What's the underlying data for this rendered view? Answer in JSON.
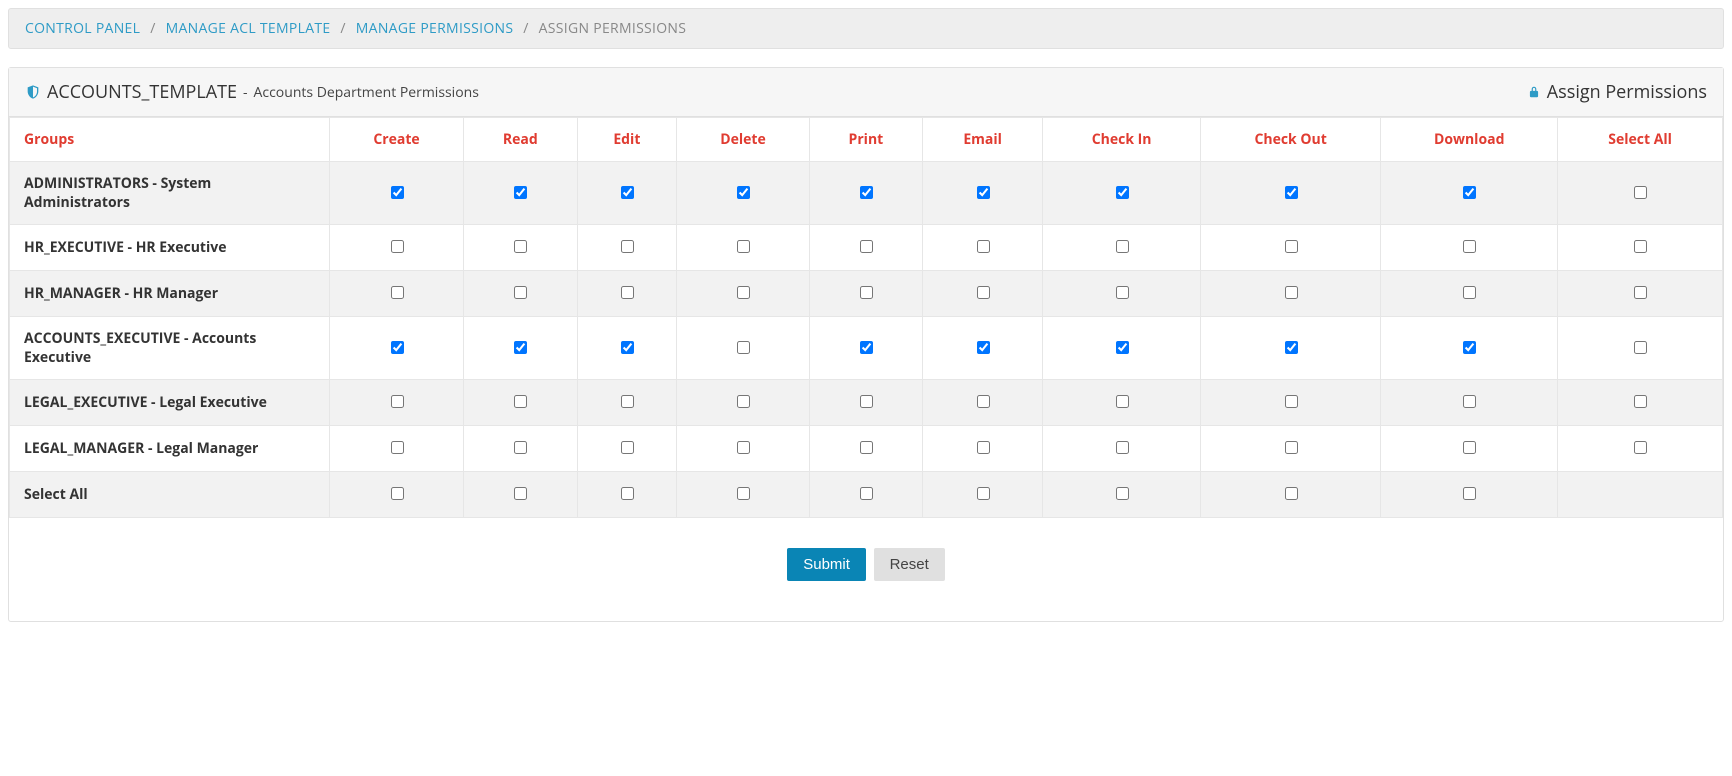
{
  "breadcrumb": {
    "items": [
      {
        "label": "CONTROL PANEL",
        "link": true
      },
      {
        "label": "MANAGE ACL TEMPLATE",
        "link": true
      },
      {
        "label": "MANAGE PERMISSIONS",
        "link": true
      },
      {
        "label": "ASSIGN PERMISSIONS",
        "link": false
      }
    ]
  },
  "panel": {
    "title_main": "ACCOUNTS_TEMPLATE",
    "title_sep": " - ",
    "title_sub": "Accounts Department Permissions",
    "title_right": "Assign Permissions"
  },
  "table": {
    "headers": [
      "Groups",
      "Create",
      "Read",
      "Edit",
      "Delete",
      "Print",
      "Email",
      "Check In",
      "Check Out",
      "Download",
      "Select All"
    ],
    "rows": [
      {
        "label": "ADMINISTRATORS - System Administrators",
        "perms": [
          true,
          true,
          true,
          true,
          true,
          true,
          true,
          true,
          true
        ],
        "selectAll": false
      },
      {
        "label": "HR_EXECUTIVE - HR Executive",
        "perms": [
          false,
          false,
          false,
          false,
          false,
          false,
          false,
          false,
          false
        ],
        "selectAll": false
      },
      {
        "label": "HR_MANAGER - HR Manager",
        "perms": [
          false,
          false,
          false,
          false,
          false,
          false,
          false,
          false,
          false
        ],
        "selectAll": false
      },
      {
        "label": "ACCOUNTS_EXECUTIVE - Accounts Executive",
        "perms": [
          true,
          true,
          true,
          false,
          true,
          true,
          true,
          true,
          true
        ],
        "selectAll": false
      },
      {
        "label": "LEGAL_EXECUTIVE - Legal Executive",
        "perms": [
          false,
          false,
          false,
          false,
          false,
          false,
          false,
          false,
          false
        ],
        "selectAll": false
      },
      {
        "label": "LEGAL_MANAGER - Legal Manager",
        "perms": [
          false,
          false,
          false,
          false,
          false,
          false,
          false,
          false,
          false
        ],
        "selectAll": false
      }
    ],
    "select_all_row_label": "Select All",
    "select_all_row": [
      false,
      false,
      false,
      false,
      false,
      false,
      false,
      false,
      false
    ]
  },
  "actions": {
    "submit": "Submit",
    "reset": "Reset"
  }
}
